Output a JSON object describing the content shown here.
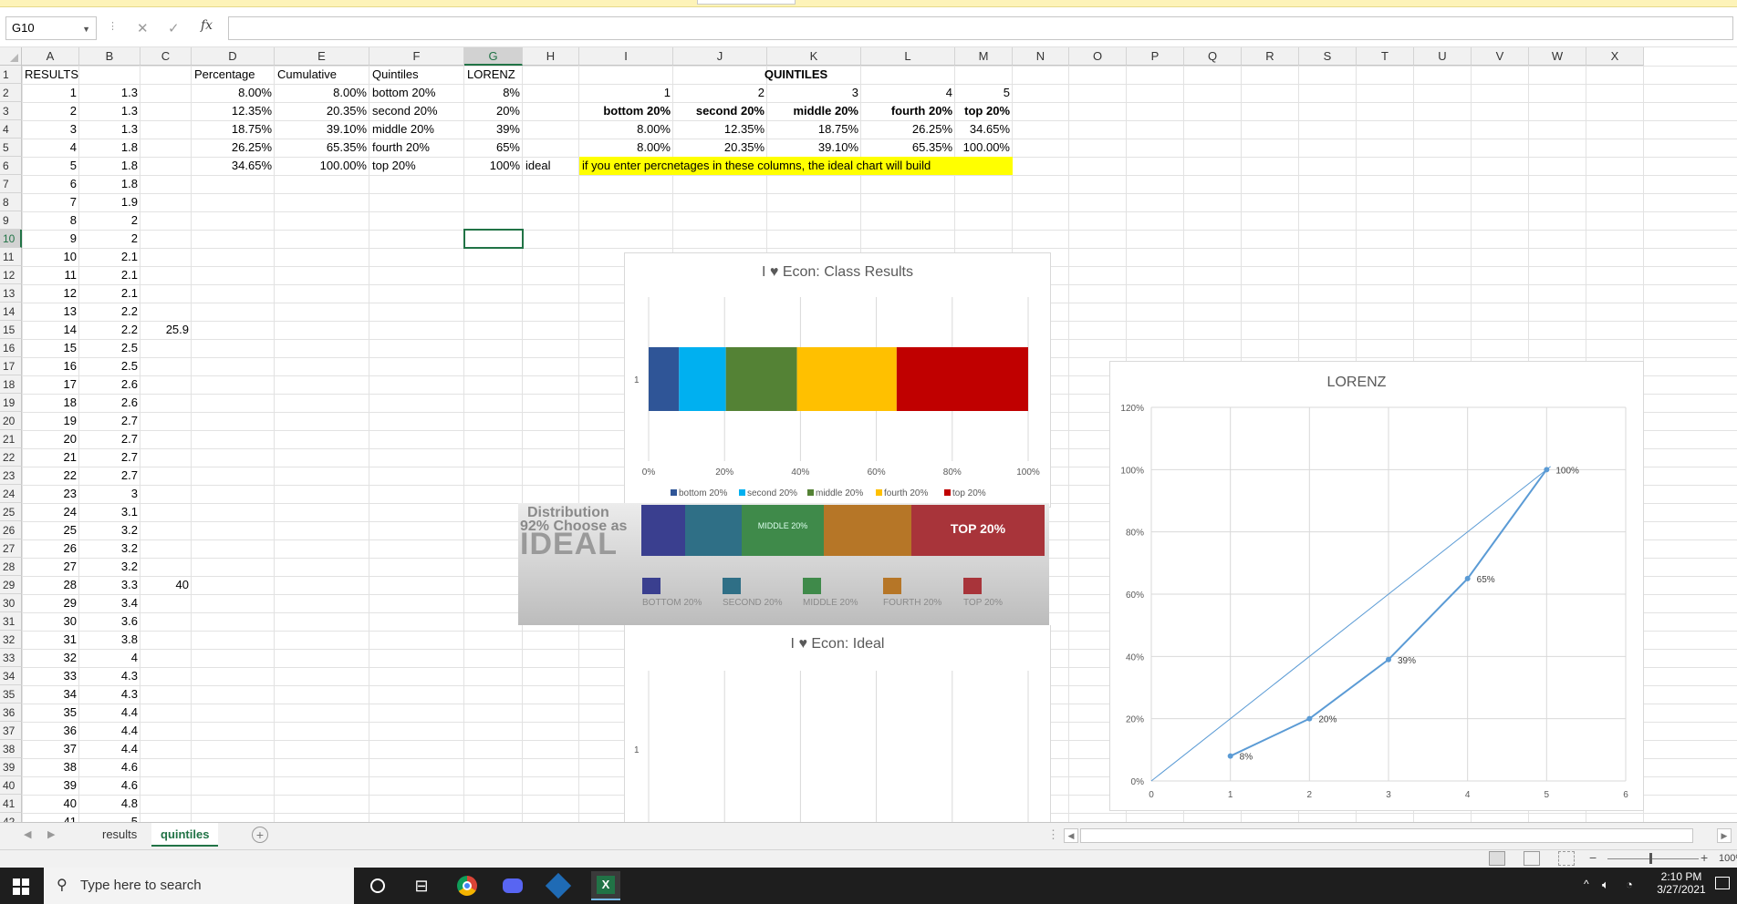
{
  "formula_bar": {
    "name_box": "G10",
    "formula": ""
  },
  "columns": [
    "A",
    "B",
    "C",
    "D",
    "E",
    "F",
    "G",
    "H",
    "I",
    "J",
    "K",
    "L",
    "M",
    "N",
    "O",
    "P",
    "Q",
    "R",
    "S",
    "T",
    "U",
    "V",
    "W",
    "X"
  ],
  "selected_column": "G",
  "selected_row": 10,
  "rows": [
    "1",
    "2",
    "3",
    "4",
    "5",
    "6",
    "7",
    "8",
    "9",
    "10",
    "11",
    "12",
    "13",
    "14",
    "15",
    "16",
    "17",
    "18",
    "19",
    "20",
    "21",
    "22",
    "23",
    "24",
    "25",
    "26",
    "27",
    "28",
    "29",
    "30",
    "31",
    "32",
    "33",
    "34",
    "35",
    "36",
    "37",
    "38",
    "39",
    "40",
    "41",
    "42"
  ],
  "col_a": [
    "RESULTS",
    "1",
    "2",
    "3",
    "4",
    "5",
    "6",
    "7",
    "8",
    "9",
    "10",
    "11",
    "12",
    "13",
    "14",
    "15",
    "16",
    "17",
    "18",
    "19",
    "20",
    "21",
    "22",
    "23",
    "24",
    "25",
    "26",
    "27",
    "28",
    "29",
    "30",
    "31",
    "32",
    "33",
    "34",
    "35",
    "36",
    "37",
    "38",
    "39",
    "40",
    "41"
  ],
  "col_b": [
    "",
    "1.3",
    "1.3",
    "1.3",
    "1.8",
    "1.8",
    "1.8",
    "1.9",
    "2",
    "2",
    "2.1",
    "2.1",
    "2.1",
    "2.2",
    "2.2",
    "2.5",
    "2.5",
    "2.6",
    "2.6",
    "2.7",
    "2.7",
    "2.7",
    "2.7",
    "3",
    "3.1",
    "3.2",
    "3.2",
    "3.2",
    "3.3",
    "3.4",
    "3.6",
    "3.8",
    "4",
    "4.3",
    "4.3",
    "4.4",
    "4.4",
    "4.4",
    "4.6",
    "4.6",
    "4.8",
    "5"
  ],
  "col_c": {
    "r15": "25.9",
    "r29": "40"
  },
  "headers_row1": {
    "D": "Percentage",
    "E": "Cumulative",
    "F": "Quintiles",
    "G": "LORENZ",
    "K": "QUINTILES"
  },
  "table_def": [
    {
      "D": "8.00%",
      "E": "8.00%",
      "F": "bottom 20%",
      "G": "8%"
    },
    {
      "D": "12.35%",
      "E": "20.35%",
      "F": "second 20%",
      "G": "20%"
    },
    {
      "D": "18.75%",
      "E": "39.10%",
      "F": "middle 20%",
      "G": "39%"
    },
    {
      "D": "26.25%",
      "E": "65.35%",
      "F": "fourth 20%",
      "G": "65%"
    },
    {
      "D": "34.65%",
      "E": "100.00%",
      "F": "top 20%",
      "G": "100%",
      "H": "ideal"
    }
  ],
  "quintiles": {
    "numbers": [
      "1",
      "2",
      "3",
      "4",
      "5"
    ],
    "names": [
      "bottom 20%",
      "second 20%",
      "middle 20%",
      "fourth 20%",
      "top 20%"
    ],
    "pct": [
      "8.00%",
      "12.35%",
      "18.75%",
      "26.25%",
      "34.65%"
    ],
    "pct2": [
      "8.00%",
      "20.35%",
      "39.10%",
      "65.35%",
      "100.00%"
    ]
  },
  "note": "if you enter percnetages in these columns, the ideal chart will build",
  "chart_data": [
    {
      "type": "bar",
      "title": "I ♥ Econ: Class Results",
      "categories": [
        "1"
      ],
      "series": [
        {
          "name": "bottom 20%",
          "values": [
            8.0
          ],
          "color": "#2f5597"
        },
        {
          "name": "second 20%",
          "values": [
            12.35
          ],
          "color": "#00b0f0"
        },
        {
          "name": "middle 20%",
          "values": [
            18.75
          ],
          "color": "#548235"
        },
        {
          "name": "fourth 20%",
          "values": [
            26.25
          ],
          "color": "#ffc000"
        },
        {
          "name": "top 20%",
          "values": [
            34.65
          ],
          "color": "#c00000"
        }
      ],
      "xticks": [
        "0%",
        "20%",
        "40%",
        "60%",
        "80%",
        "100%"
      ],
      "stacked": true,
      "orientation": "horizontal",
      "legend": "bottom"
    },
    {
      "type": "bar",
      "title": "I ♥ Econ: Ideal",
      "categories": [
        "1"
      ],
      "series": [],
      "stacked": true,
      "orientation": "horizontal"
    },
    {
      "type": "scatter",
      "title": "LORENZ",
      "x": [
        1,
        2,
        3,
        4,
        5
      ],
      "series": [
        {
          "name": "",
          "values": [
            8,
            20,
            39,
            65,
            100
          ],
          "labels": [
            "8%",
            "20%",
            "39%",
            "65%",
            "100%"
          ]
        }
      ],
      "reference_line": {
        "from": [
          0,
          0
        ],
        "to": [
          5,
          100
        ]
      },
      "xlim": [
        0,
        6
      ],
      "ylim": [
        0,
        120
      ],
      "yticks": [
        "0%",
        "20%",
        "40%",
        "60%",
        "80%",
        "100%",
        "120%"
      ],
      "xticks": [
        "0",
        "1",
        "2",
        "3",
        "4",
        "5",
        "6"
      ],
      "grid": true
    }
  ],
  "ideal_image": {
    "heading1": "Distribution",
    "heading2": "92% Choose as",
    "heading3": "IDEAL",
    "bar_colors": [
      "#3a3f8f",
      "#2f6f86",
      "#3f8a4a",
      "#b67627",
      "#a8343a"
    ],
    "middle_label": "MIDDLE 20%",
    "top_label": "TOP 20%",
    "legend": [
      "BOTTOM 20%",
      "SECOND 20%",
      "MIDDLE 20%",
      "FOURTH 20%",
      "TOP 20%"
    ]
  },
  "sheet_tabs": [
    "results",
    "quintiles"
  ],
  "active_tab": "quintiles",
  "status": {
    "zoom": "100%"
  },
  "taskbar": {
    "search_placeholder": "Type here to search",
    "time": "2:10 PM",
    "date": "3/27/2021"
  }
}
